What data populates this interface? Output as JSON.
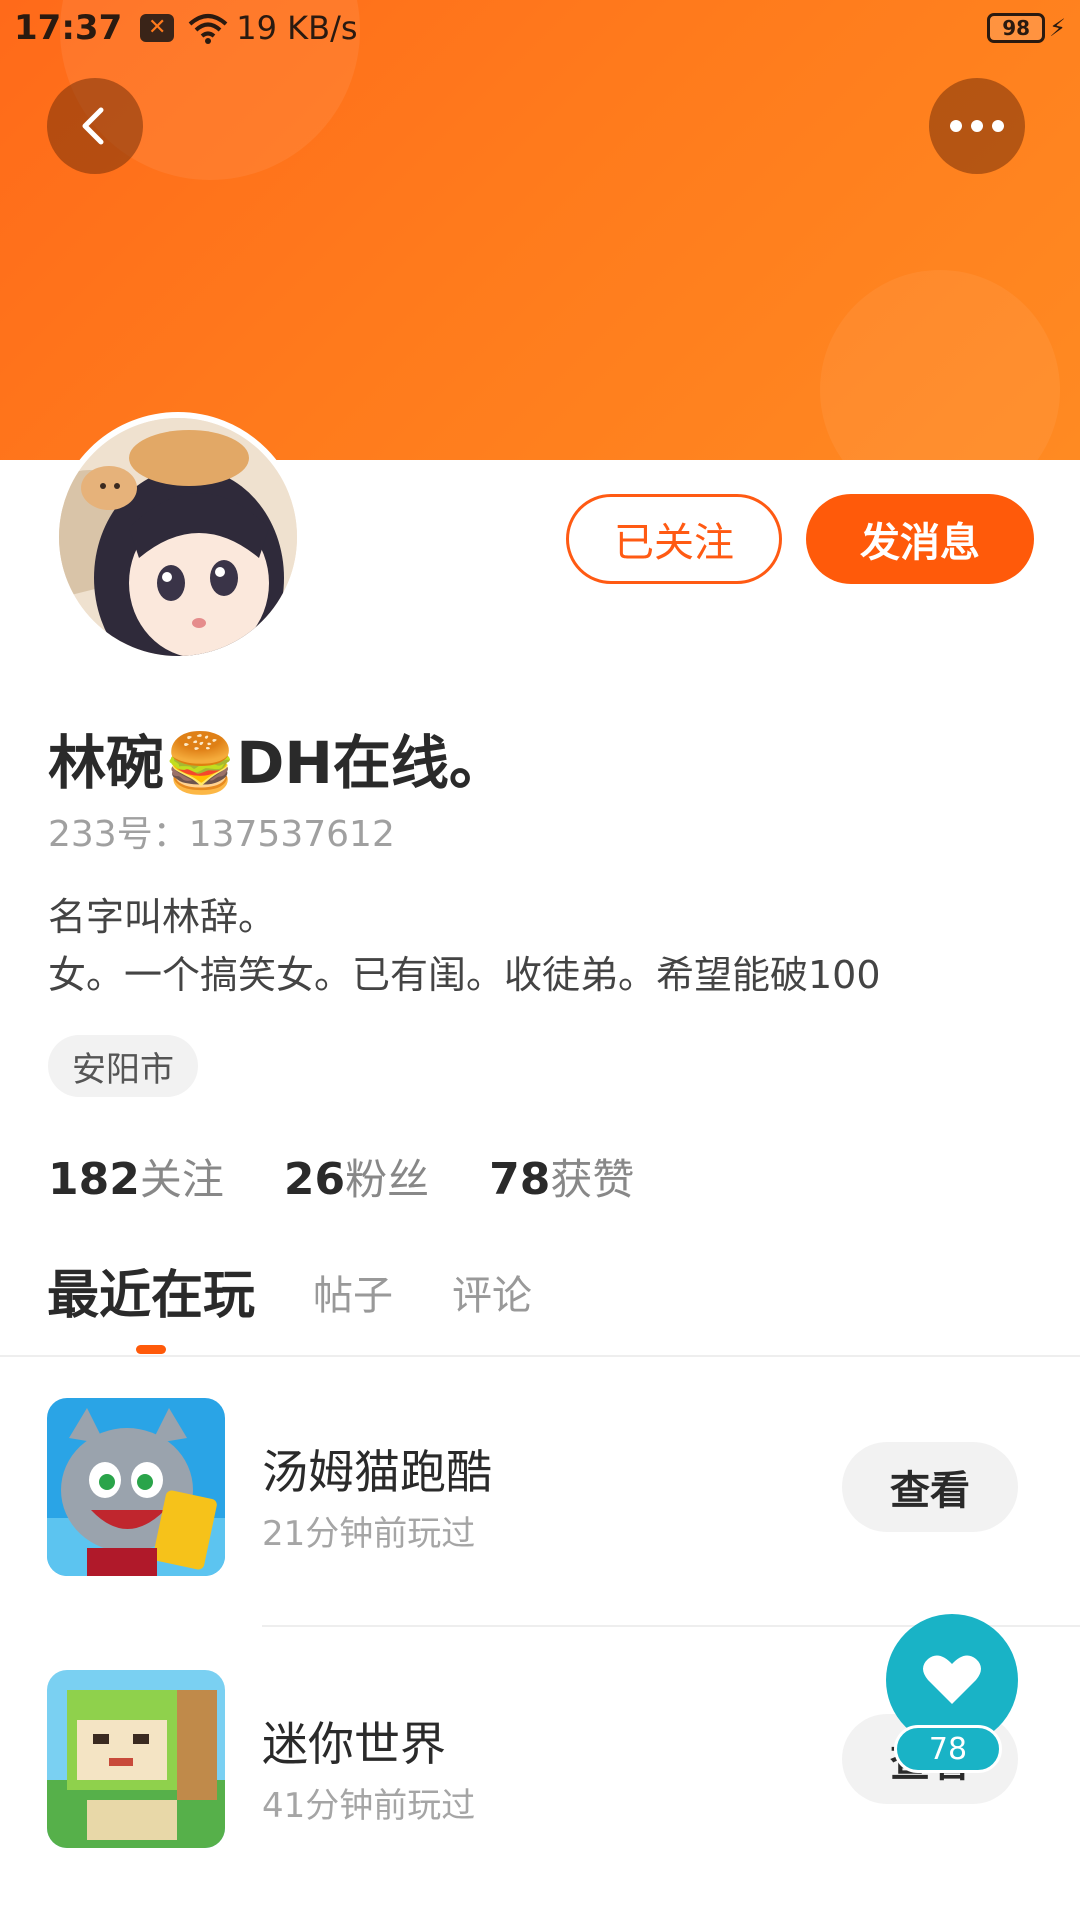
{
  "status_bar": {
    "time": "17:37",
    "notification_icon": "close-box-icon",
    "wifi_icon": "wifi-icon",
    "speed": "19 KB/s",
    "battery": "98",
    "charging_icon": "bolt-icon"
  },
  "header": {
    "back_icon": "chevron-left-icon",
    "more_icon": "more-horizontal-icon",
    "accent_color": "#ff6a1a"
  },
  "profile": {
    "avatar_icon": "avatar-anime-girl",
    "follow_label": "已关注",
    "message_label": "发消息",
    "username": "林碗🍔DH在线。",
    "user_id": "233号：137537612",
    "bio_line1": "名字叫林辞。",
    "bio_line2": "女。一个搞笑女。已有闺。收徒弟。希望能破100",
    "location": "安阳市"
  },
  "stats": {
    "following_num": "182",
    "following_label": "关注",
    "fans_num": "26",
    "fans_label": "粉丝",
    "likes_num": "78",
    "likes_label": "获赞"
  },
  "tabs": {
    "recent": "最近在玩",
    "posts": "帖子",
    "comments": "评论",
    "active_color": "#ff5a0a"
  },
  "games": [
    {
      "name": "汤姆猫跑酷",
      "time": "21分钟前玩过",
      "button": "查看",
      "icon": "tom-cat-game-icon"
    },
    {
      "name": "迷你世界",
      "time": "41分钟前玩过",
      "button": "查看",
      "icon": "mini-world-game-icon"
    }
  ],
  "like_fab": {
    "icon": "heart-icon",
    "count": "78",
    "color": "#19b3c6"
  }
}
